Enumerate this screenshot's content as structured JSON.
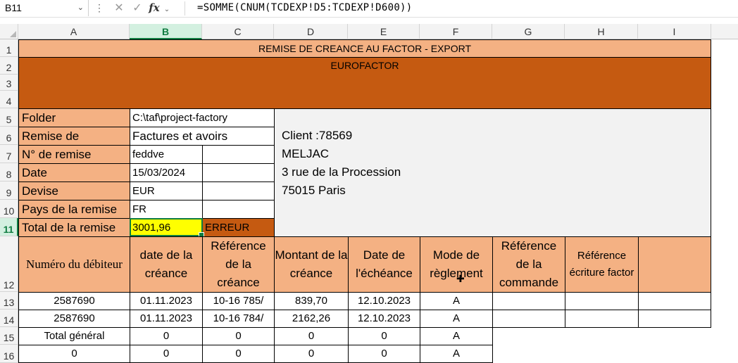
{
  "formula_bar": {
    "name_box": "B11",
    "formula": "=SOMME(CNUM(TCDEXP!D5:TCDEXP!D600))"
  },
  "columns": [
    "A",
    "B",
    "C",
    "D",
    "E",
    "F",
    "G",
    "H",
    "I"
  ],
  "selected_column": "B",
  "rows": [
    "1",
    "2",
    "3",
    "4",
    "5",
    "6",
    "7",
    "8",
    "9",
    "10",
    "11",
    "12",
    "13",
    "14",
    "15",
    "16"
  ],
  "selected_row": "11",
  "sheet": {
    "title": "REMISE DE CREANCE AU FACTOR - EXPORT",
    "factor": "EUROFACTOR",
    "fields": {
      "folder_label": "Folder",
      "folder_value": "C:\\taf\\project-factory",
      "remise_label": "Remise de",
      "remise_value": "Factures et avoirs",
      "num_label": "N° de remise",
      "num_value": "feddve",
      "date_label": "Date",
      "date_value": "15/03/2024",
      "devise_label": "Devise",
      "devise_value": "EUR",
      "pays_label": "Pays de la remise",
      "pays_value": "FR",
      "total_label": "Total de la remise",
      "total_value": "3001,96",
      "total_status": "ERREUR"
    },
    "client": {
      "line1": "Client :78569",
      "line2": "MELJAC",
      "line3": "3 rue de la Procession",
      "line4": "75015 Paris"
    },
    "table_headers": {
      "a": "Numéro du débiteur",
      "b": "date de la créance",
      "c": "Référence de la créance",
      "d": "Montant de la créance",
      "e": "Date de l'échéance",
      "f": "Mode de règlement",
      "g": "Référence de la commande",
      "h": "Référence écriture factor"
    },
    "table_rows": [
      {
        "a": "2587690",
        "b": "01.11.2023",
        "c": "10-16 785/",
        "d": "839,70",
        "e": "12.10.2023",
        "f": "A"
      },
      {
        "a": "2587690",
        "b": "01.11.2023",
        "c": "10-16 784/",
        "d": "2162,26",
        "e": "12.10.2023",
        "f": "A"
      },
      {
        "a": "Total général",
        "b": "0",
        "c": "0",
        "d": "0",
        "e": "0",
        "f": "A"
      },
      {
        "a": "0",
        "b": "0",
        "c": "0",
        "d": "0",
        "e": "0",
        "f": "A"
      }
    ]
  }
}
